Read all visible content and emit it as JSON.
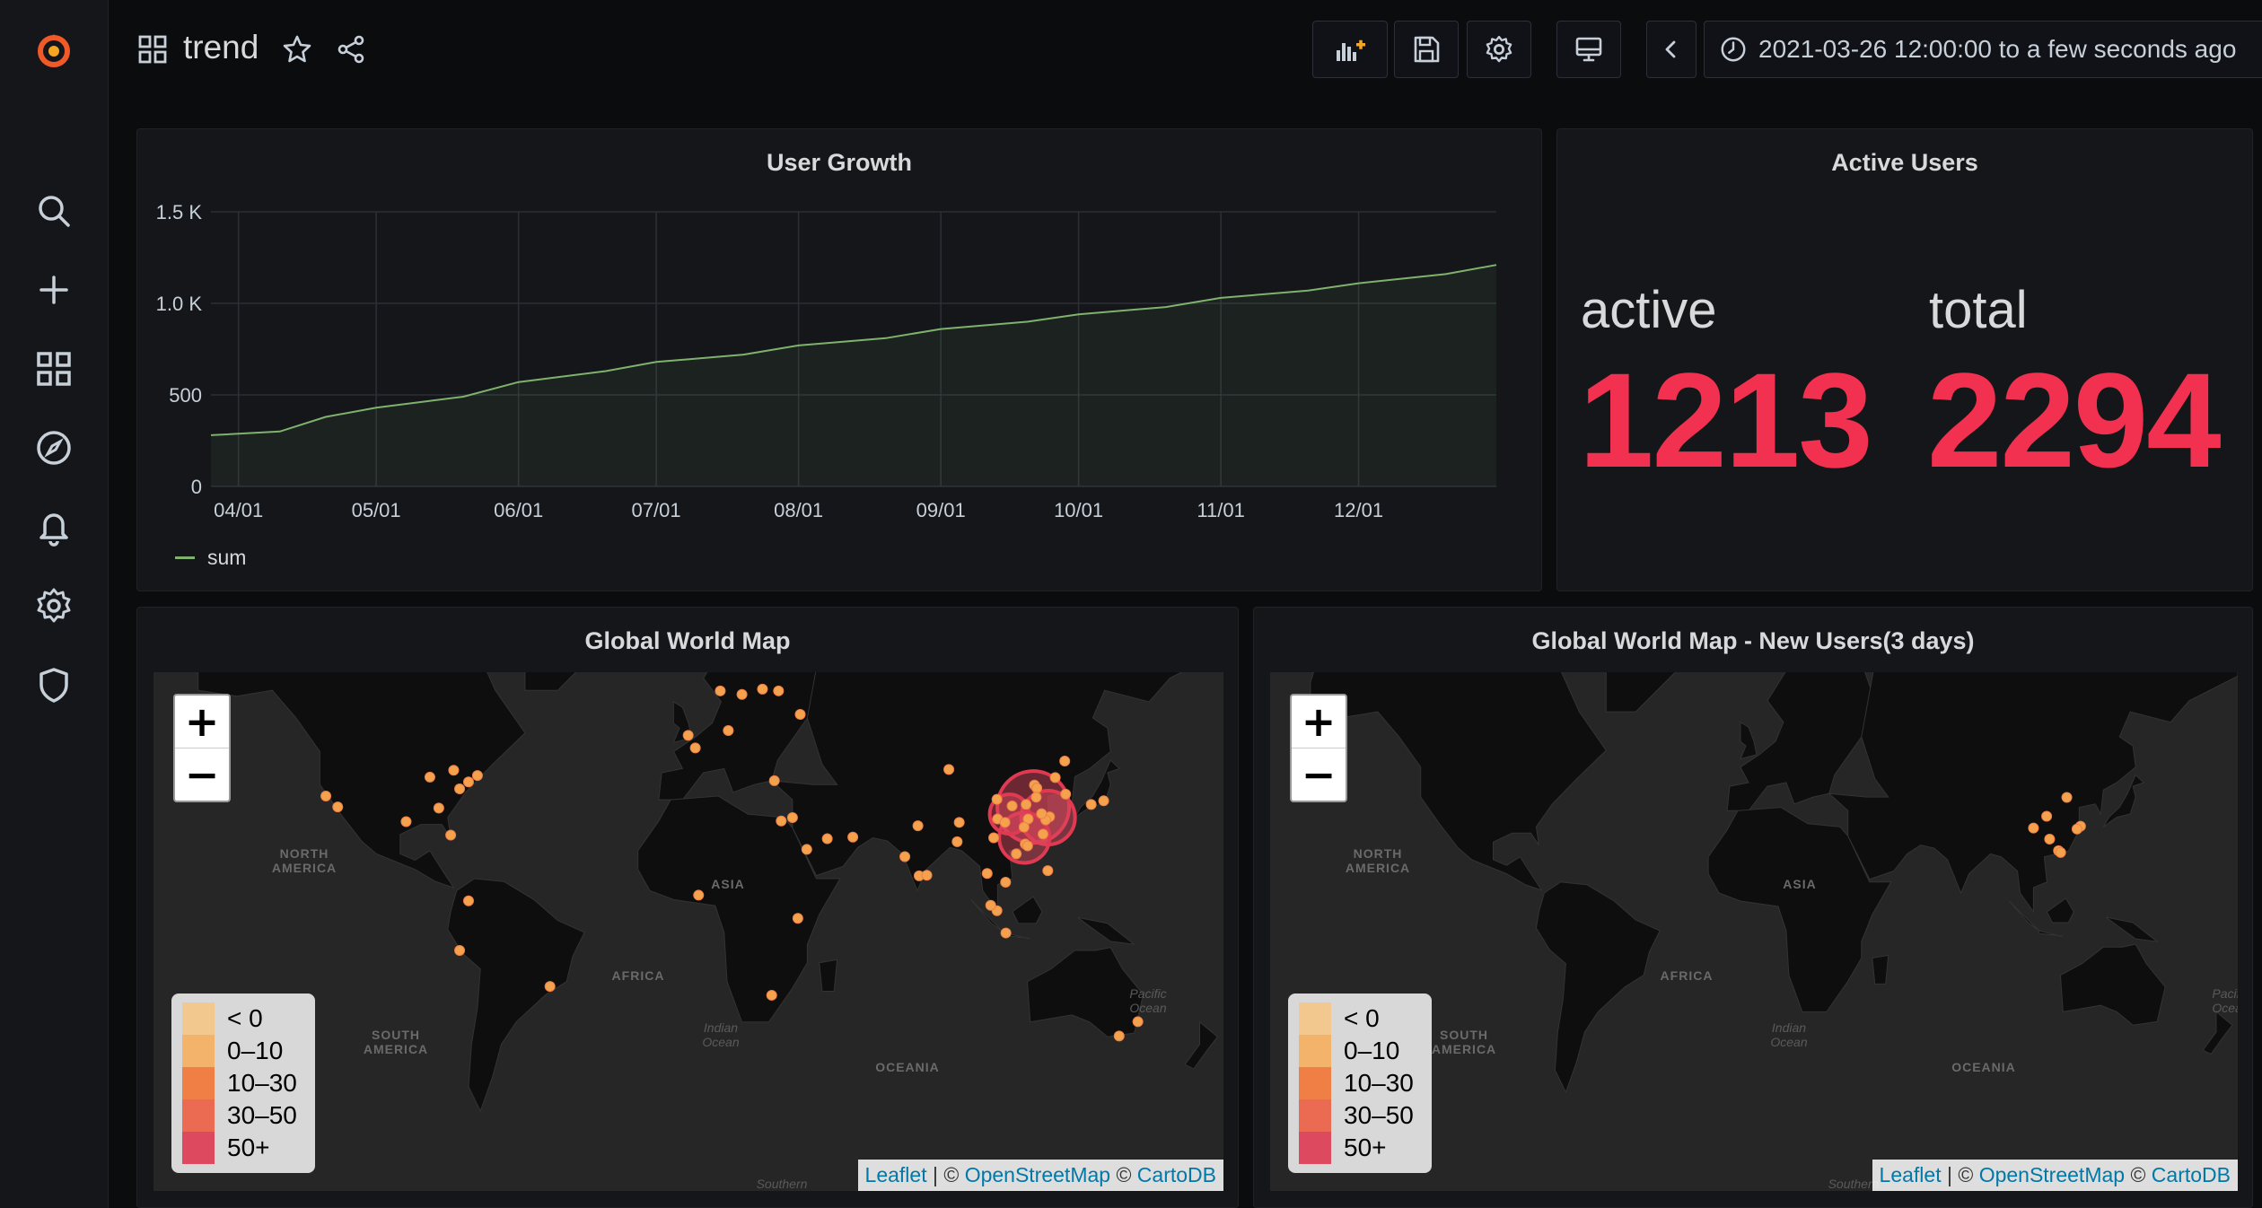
{
  "topbar": {
    "title": "trend",
    "time_range": "2021-03-26 12:00:00 to a few seconds ago"
  },
  "panels": {
    "user_growth": {
      "title": "User Growth",
      "legend_label": "sum"
    },
    "active_users": {
      "title": "Active Users",
      "active_label": "active",
      "active_value": "1213",
      "total_label": "total",
      "total_value": "2294"
    },
    "world_map": {
      "title": "Global World Map"
    },
    "world_map_new": {
      "title": "Global World Map - New Users(3 days)"
    }
  },
  "map_common": {
    "zoom_in": "+",
    "zoom_out": "−",
    "legend": [
      {
        "label": "< 0",
        "color": "#f3c88e"
      },
      {
        "label": "0–10",
        "color": "#f4b36a"
      },
      {
        "label": "10–30",
        "color": "#f07f45"
      },
      {
        "label": "30–50",
        "color": "#ea6a52"
      },
      {
        "label": "50+",
        "color": "#dd4a5f"
      }
    ],
    "attribution": {
      "leaflet": "Leaflet",
      "osm": "OpenStreetMap",
      "carto": "CartoDB",
      "sep": " | © ",
      "sep2": " © "
    },
    "region_labels": {
      "north_america": "NORTH AMERICA",
      "south_america": "SOUTH AMERICA",
      "africa": "AFRICA",
      "asia": "ASIA",
      "oceania": "OCEANIA",
      "indian_ocean": "Indian Ocean",
      "pacific_ocean": "Pacific Ocean",
      "southern": "Southern"
    }
  },
  "colors": {
    "accent_red": "#f2304f",
    "series_green": "#7eb26d",
    "grafana_orange": "#f05a28"
  },
  "chart_data": {
    "type": "area",
    "title": "User Growth",
    "series": [
      {
        "name": "sum",
        "x": [
          "2021-03-26",
          "2021-04-10",
          "2021-04-20",
          "2021-05-01",
          "2021-05-20",
          "2021-06-01",
          "2021-06-20",
          "2021-07-01",
          "2021-07-20",
          "2021-08-01",
          "2021-08-20",
          "2021-09-01",
          "2021-09-20",
          "2021-10-01",
          "2021-10-20",
          "2021-11-01",
          "2021-11-20",
          "2021-12-01",
          "2021-12-20",
          "2021-12-31"
        ],
        "y": [
          280,
          300,
          380,
          430,
          490,
          570,
          630,
          680,
          720,
          770,
          810,
          860,
          900,
          940,
          980,
          1030,
          1070,
          1110,
          1160,
          1210
        ]
      }
    ],
    "x_ticks": [
      "04/01",
      "05/01",
      "06/01",
      "07/01",
      "08/01",
      "09/01",
      "10/01",
      "11/01",
      "12/01"
    ],
    "y_ticks": [
      "0",
      "500",
      "1.0 K",
      "1.5 K"
    ],
    "ylim": [
      0,
      1500
    ],
    "grid": true,
    "legend_position": "bottom-left"
  },
  "maps": {
    "world_markers": [
      {
        "lon": -118,
        "lat": 34
      },
      {
        "lon": -122,
        "lat": 37
      },
      {
        "lon": -87,
        "lat": 41.9
      },
      {
        "lon": -74,
        "lat": 40.7
      },
      {
        "lon": -71,
        "lat": 42.3
      },
      {
        "lon": -77,
        "lat": 38.9
      },
      {
        "lon": -80,
        "lat": 25.8
      },
      {
        "lon": -95,
        "lat": 29.8
      },
      {
        "lon": -84,
        "lat": 33.7
      },
      {
        "lon": -79,
        "lat": 43.6
      },
      {
        "lon": -0.1,
        "lat": 51.5
      },
      {
        "lon": 2.3,
        "lat": 48.8
      },
      {
        "lon": 13.4,
        "lat": 52.5
      },
      {
        "lon": 18,
        "lat": 59.3
      },
      {
        "lon": 10.7,
        "lat": 59.9
      },
      {
        "lon": 55.3,
        "lat": 25.2
      },
      {
        "lon": 46.7,
        "lat": 24.7
      },
      {
        "lon": 39.8,
        "lat": 21.4
      },
      {
        "lon": 35,
        "lat": 31
      },
      {
        "lon": 72.8,
        "lat": 19.1
      },
      {
        "lon": 77.2,
        "lat": 28.6
      },
      {
        "lon": 77.6,
        "lat": 12.9
      },
      {
        "lon": 80.2,
        "lat": 13.1
      },
      {
        "lon": 100.5,
        "lat": 13.7
      },
      {
        "lon": 103.8,
        "lat": 1.3
      },
      {
        "lon": 101.7,
        "lat": 3.1
      },
      {
        "lon": 106.8,
        "lat": -6.2
      },
      {
        "lon": 106.7,
        "lat": 10.8
      },
      {
        "lon": 120.9,
        "lat": 14.6
      },
      {
        "lon": 126.9,
        "lat": 37.5
      },
      {
        "lon": 139.7,
        "lat": 35.7
      },
      {
        "lon": 135.5,
        "lat": 34.7
      },
      {
        "lon": 116.4,
        "lat": 39.9
      },
      {
        "lon": 121.5,
        "lat": 31.2
      },
      {
        "lon": 113.3,
        "lat": 23.1
      },
      {
        "lon": 114.1,
        "lat": 22.5
      },
      {
        "lon": 104,
        "lat": 30.6
      },
      {
        "lon": 108.9,
        "lat": 34.3
      },
      {
        "lon": 114.3,
        "lat": 30.6
      },
      {
        "lon": 120.2,
        "lat": 30.3
      },
      {
        "lon": 118.8,
        "lat": 32.1
      },
      {
        "lon": 117.2,
        "lat": 39.1
      },
      {
        "lon": 112.9,
        "lat": 28.2
      },
      {
        "lon": 106.5,
        "lat": 29.6
      },
      {
        "lon": 123.4,
        "lat": 41.8
      },
      {
        "lon": 126.6,
        "lat": 45.8
      },
      {
        "lon": 119.3,
        "lat": 26.1
      },
      {
        "lon": 110.3,
        "lat": 20
      },
      {
        "lon": 102.7,
        "lat": 25
      },
      {
        "lon": 113.6,
        "lat": 34.7
      },
      {
        "lon": 117,
        "lat": 36.7
      },
      {
        "lon": 103.8,
        "lat": 36.1
      },
      {
        "lon": 91.1,
        "lat": 29.6
      },
      {
        "lon": 87.6,
        "lat": 43.8
      },
      {
        "lon": 28,
        "lat": -26.2
      },
      {
        "lon": 36.8,
        "lat": -1.3
      },
      {
        "lon": 3.4,
        "lat": 6.5
      },
      {
        "lon": 31.2,
        "lat": 30
      },
      {
        "lon": -46.6,
        "lat": -23.5
      },
      {
        "lon": -74,
        "lat": 4.6
      },
      {
        "lon": -77,
        "lat": -12
      },
      {
        "lon": 151.2,
        "lat": -33.9
      },
      {
        "lon": 144.9,
        "lat": -37.8
      },
      {
        "lon": 37.6,
        "lat": 55.7
      },
      {
        "lon": 30.3,
        "lat": 59.9
      },
      {
        "lon": 28.9,
        "lat": 41
      },
      {
        "lon": 24.9,
        "lat": 60.2
      },
      {
        "lon": 90.4,
        "lat": 23.8
      }
    ],
    "world_clusters": [
      {
        "lon": 116,
        "lat": 34,
        "r": 40
      },
      {
        "lon": 121,
        "lat": 31,
        "r": 30
      },
      {
        "lon": 113,
        "lat": 25,
        "r": 28
      },
      {
        "lon": 108,
        "lat": 32,
        "r": 22
      }
    ],
    "new_markers": [
      {
        "lon": 116.4,
        "lat": 39.9
      },
      {
        "lon": 121.5,
        "lat": 31.2
      },
      {
        "lon": 113.3,
        "lat": 23.1
      },
      {
        "lon": 114.1,
        "lat": 22.5
      },
      {
        "lon": 104,
        "lat": 30.6
      },
      {
        "lon": 108.9,
        "lat": 34.3
      },
      {
        "lon": 120.2,
        "lat": 30.3
      },
      {
        "lon": 110,
        "lat": 27
      }
    ]
  }
}
